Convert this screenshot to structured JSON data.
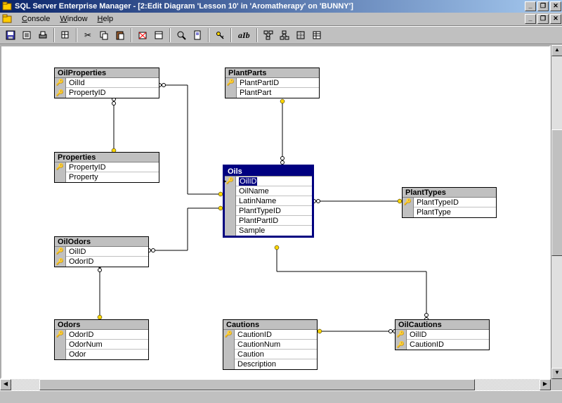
{
  "window": {
    "title": "SQL Server Enterprise Manager - [2:Edit Diagram 'Lesson 10' in 'Aromatherapy' on 'BUNNY']"
  },
  "menus": {
    "console": "Console",
    "window": "Window",
    "help": "Help"
  },
  "toolbar": {
    "alb_label": "aIb"
  },
  "tables": {
    "OilProperties": {
      "title": "OilProperties",
      "cols": [
        "OilId",
        "PropertyID"
      ],
      "keys": [
        true,
        true
      ]
    },
    "Properties": {
      "title": "Properties",
      "cols": [
        "PropertyID",
        "Property"
      ],
      "keys": [
        true,
        false
      ]
    },
    "OilOdors": {
      "title": "OilOdors",
      "cols": [
        "OilID",
        "OdorID"
      ],
      "keys": [
        true,
        true
      ]
    },
    "Odors": {
      "title": "Odors",
      "cols": [
        "OdorID",
        "OdorNum",
        "Odor"
      ],
      "keys": [
        true,
        false,
        false
      ]
    },
    "PlantParts": {
      "title": "PlantParts",
      "cols": [
        "PlantPartID",
        "PlantPart"
      ],
      "keys": [
        true,
        false
      ]
    },
    "Oils": {
      "title": "Oils",
      "cols": [
        "OilID",
        "OilName",
        "LatinName",
        "PlantTypeID",
        "PlantPartID",
        "Sample"
      ],
      "keys": [
        true,
        false,
        false,
        false,
        false,
        false
      ]
    },
    "PlantTypes": {
      "title": "PlantTypes",
      "cols": [
        "PlantTypeID",
        "PlantType"
      ],
      "keys": [
        true,
        false
      ]
    },
    "Cautions": {
      "title": "Cautions",
      "cols": [
        "CautionID",
        "CautionNum",
        "Caution",
        "Description"
      ],
      "keys": [
        true,
        false,
        false,
        false
      ]
    },
    "OilCautions": {
      "title": "OilCautions",
      "cols": [
        "OilID",
        "CautionID"
      ],
      "keys": [
        true,
        true
      ]
    }
  },
  "relationships": [
    [
      "OilProperties",
      "Properties"
    ],
    [
      "OilProperties",
      "Oils"
    ],
    [
      "OilOdors",
      "Odors"
    ],
    [
      "OilOdors",
      "Oils"
    ],
    [
      "PlantParts",
      "Oils"
    ],
    [
      "Oils",
      "PlantTypes"
    ],
    [
      "Oils",
      "OilCautions"
    ],
    [
      "Cautions",
      "OilCautions"
    ]
  ]
}
